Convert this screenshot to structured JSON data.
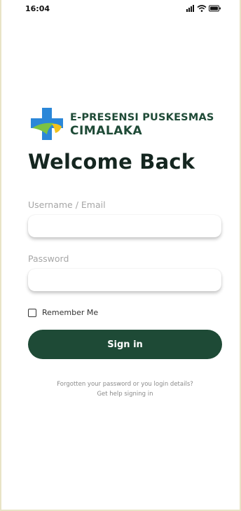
{
  "status_bar": {
    "time": "16:04",
    "icons": [
      "signal-icon",
      "wifi-icon",
      "battery-icon"
    ]
  },
  "brand": {
    "line1": "E-PRESENSI PUSKESMAS",
    "line2": "CIMALAKA",
    "color": "#1e4a36",
    "logo_colors": {
      "cross": "#2b87d8",
      "accent_green": "#7cc242",
      "accent_yellow": "#f2c21a"
    }
  },
  "heading": "Welcome Back",
  "form": {
    "username": {
      "label": "Username / Email",
      "value": "",
      "placeholder": ""
    },
    "password": {
      "label": "Password",
      "value": "",
      "placeholder": ""
    },
    "remember_me": {
      "label": "Remember Me",
      "checked": false
    },
    "submit_label": "Sign in",
    "submit_color": "#1e4a36"
  },
  "help": {
    "line1": "Forgotten your password or you login details?",
    "line2": "Get help signing in"
  }
}
